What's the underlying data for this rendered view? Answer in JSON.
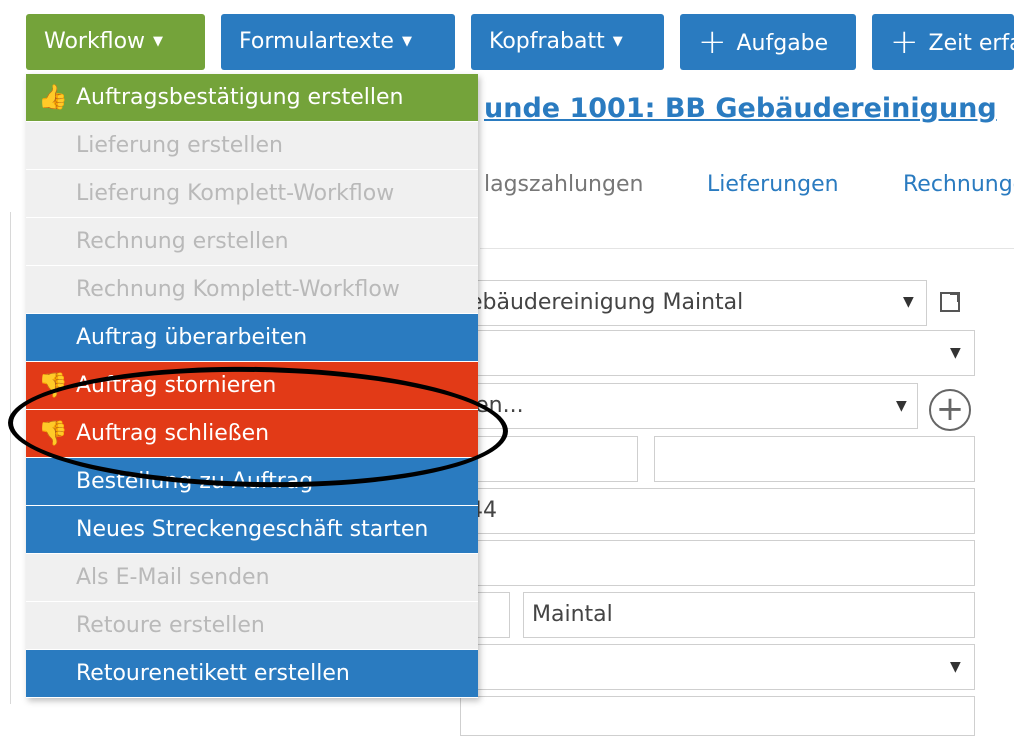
{
  "toolbar": {
    "workflow": "Workflow",
    "formulartexte": "Formulartexte",
    "kopfrabatt": "Kopfrabatt",
    "aufgabe": "Aufgabe",
    "zeit": "Zeit erfassen"
  },
  "title": "unde 1001: BB Gebäudereinigung",
  "tabs": [
    "lagszahlungen",
    "Lieferungen",
    "Rechnungen"
  ],
  "form": {
    "customer": "ebäudereinigung Maintal",
    "contact": "len...",
    "phone": "44",
    "city": "Maintal"
  },
  "menu": {
    "items": [
      {
        "label": "Auftragsbestätigung erstellen",
        "style": "green",
        "icon": "thumbs-up-icon"
      },
      {
        "label": "Lieferung erstellen",
        "style": "disabled"
      },
      {
        "label": "Lieferung Komplett-Workflow",
        "style": "disabled"
      },
      {
        "label": "Rechnung erstellen",
        "style": "disabled"
      },
      {
        "label": "Rechnung Komplett-Workflow",
        "style": "disabled"
      },
      {
        "label": "Auftrag überarbeiten",
        "style": "blue"
      },
      {
        "label": "Auftrag stornieren",
        "style": "red",
        "icon": "thumbs-down-icon"
      },
      {
        "label": "Auftrag schließen",
        "style": "red",
        "icon": "thumbs-down-icon"
      },
      {
        "label": "Bestellung zu Auftrag",
        "style": "blue"
      },
      {
        "label": "Neues Streckengeschäft starten",
        "style": "blue"
      },
      {
        "label": "Als E-Mail senden",
        "style": "disabled"
      },
      {
        "label": "Retoure erstellen",
        "style": "disabled"
      },
      {
        "label": "Retourenetikett erstellen",
        "style": "blue"
      }
    ]
  },
  "colors": {
    "green": "#74a33a",
    "blue": "#2a7bc0",
    "red": "#e23a17",
    "disabled_text": "#b9b9b9"
  }
}
